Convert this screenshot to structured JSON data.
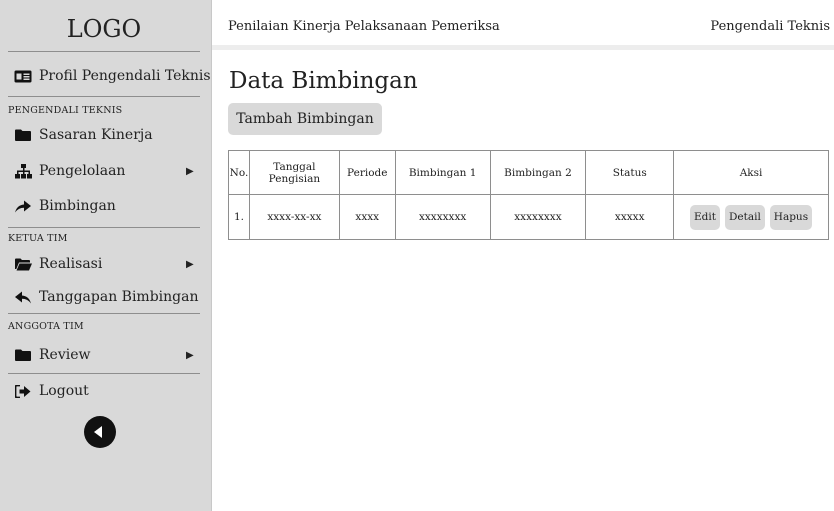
{
  "sidebar": {
    "logo": "LOGO",
    "profile_label": "Profil Pengendali Teknis",
    "section_pengendali": "PENGENDALI TEKNIS",
    "sasaran_label": "Sasaran Kinerja",
    "pengelolaan_label": "Pengelolaan",
    "bimbingan_label": "Bimbingan",
    "section_ketua": "KETUA TIM",
    "realisasi_label": "Realisasi",
    "tanggapan_label": "Tanggapan Bimbingan",
    "section_anggota": "ANGGOTA TIM",
    "review_label": "Review",
    "logout_label": "Logout"
  },
  "topbar": {
    "app_title": "Penilaian Kinerja Pelaksanaan Pemeriksa",
    "user_role": "Pengendali Teknis"
  },
  "main": {
    "title": "Data Bimbingan",
    "add_button": "Tambah Bimbingan",
    "table": {
      "headers": {
        "no": "No.",
        "tanggal_line1": "Tanggal",
        "tanggal_line2": "Pengisian",
        "periode": "Periode",
        "bimbingan1": "Bimbingan 1",
        "bimbingan2": "Bimbingan 2",
        "status": "Status",
        "aksi": "Aksi"
      },
      "rows": [
        {
          "no": "1.",
          "tanggal": "xxxx-xx-xx",
          "periode": "xxxx",
          "bimbingan1": "xxxxxxxx",
          "bimbingan2": "xxxxxxxx",
          "status": "xxxxx",
          "edit": "Edit",
          "detail": "Detail",
          "hapus": "Hapus"
        }
      ]
    }
  },
  "icons": {
    "profile": "id-card-icon",
    "sasaran": "folder-icon",
    "pengelolaan": "sitemap-icon",
    "bimbingan": "share-arrow-icon",
    "realisasi": "folder-open-icon",
    "tanggapan": "reply-arrow-icon",
    "review": "folder-icon",
    "logout": "sign-out-icon",
    "back": "circle-back-icon"
  },
  "colors": {
    "sidebar_bg": "#d9d9d9",
    "button_bg": "#d9d9d9",
    "text": "#222222"
  }
}
